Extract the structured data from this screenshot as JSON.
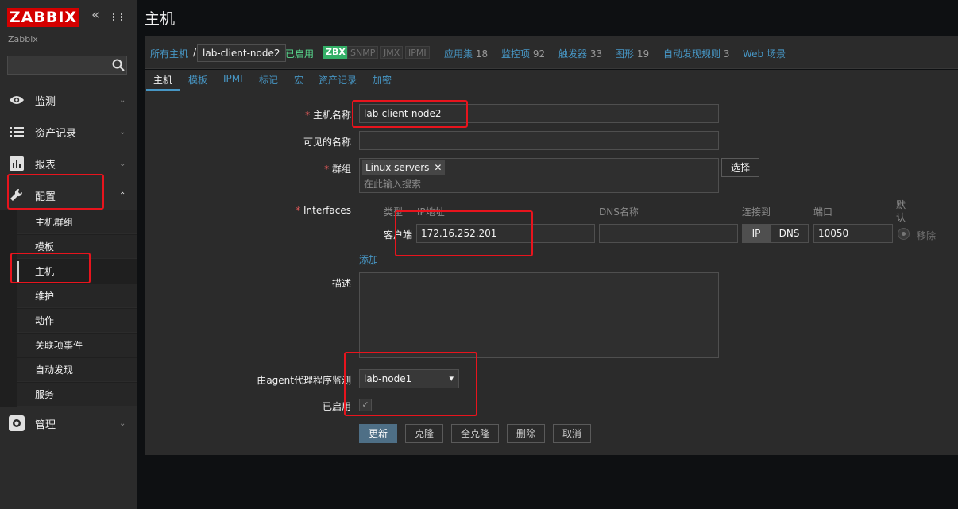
{
  "sidebar": {
    "logo": "ZABBIX",
    "server_name": "Zabbix",
    "search_placeholder": "",
    "menu": [
      {
        "label": "监测",
        "icon": "eye-icon"
      },
      {
        "label": "资产记录",
        "icon": "list-icon"
      },
      {
        "label": "报表",
        "icon": "bar-chart-icon"
      },
      {
        "label": "配置",
        "icon": "wrench-icon"
      },
      {
        "label": "管理",
        "icon": "gear-icon"
      }
    ],
    "config_submenu": [
      "主机群组",
      "模板",
      "主机",
      "维护",
      "动作",
      "关联项事件",
      "自动发现",
      "服务"
    ]
  },
  "header": {
    "title": "主机"
  },
  "breadcrumb": {
    "all_hosts": "所有主机",
    "separator": "/",
    "current": "lab-client-node2",
    "enabled": "已启用",
    "availability": [
      "ZBX",
      "SNMP",
      "JMX",
      "IPMI"
    ]
  },
  "nav_links": [
    {
      "label": "应用集",
      "count": "18"
    },
    {
      "label": "监控项",
      "count": "92"
    },
    {
      "label": "触发器",
      "count": "33"
    },
    {
      "label": "图形",
      "count": "19"
    },
    {
      "label": "自动发现规则",
      "count": "3"
    },
    {
      "label": "Web 场景",
      "count": ""
    }
  ],
  "tabs": [
    "主机",
    "模板",
    "IPMI",
    "标记",
    "宏",
    "资产记录",
    "加密"
  ],
  "form": {
    "host_name_label": "主机名称",
    "host_name_value": "lab-client-node2",
    "visible_name_label": "可见的名称",
    "visible_name_value": "",
    "groups_label": "群组",
    "group_chip": "Linux servers",
    "group_chip_remove": "✕",
    "groups_placeholder": "在此输入搜索",
    "select_button": "选择",
    "interfaces_label": "Interfaces",
    "interface_headers": {
      "type": "类型",
      "ip": "IP地址",
      "dns": "DNS名称",
      "connect": "连接到",
      "port": "端口",
      "default": "默认"
    },
    "interface_row": {
      "type": "客户端",
      "ip": "172.16.252.201",
      "dns": "",
      "conn_ip": "IP",
      "conn_dns": "DNS",
      "port": "10050",
      "remove": "移除"
    },
    "add_link": "添加",
    "description_label": "描述",
    "proxy_label": "由agent代理程序监测",
    "proxy_value": "lab-node1",
    "enabled_label": "已启用",
    "enabled_checked": true,
    "required_mark": "*"
  },
  "buttons": {
    "update": "更新",
    "clone": "克隆",
    "full_clone": "全克隆",
    "delete": "删除",
    "cancel": "取消"
  },
  "colors": {
    "logo_red": "#d40000",
    "link_blue": "#4796c4",
    "enabled_green": "#59db8f",
    "zbx_green": "#34af67",
    "highlight_red": "#e8141d"
  }
}
